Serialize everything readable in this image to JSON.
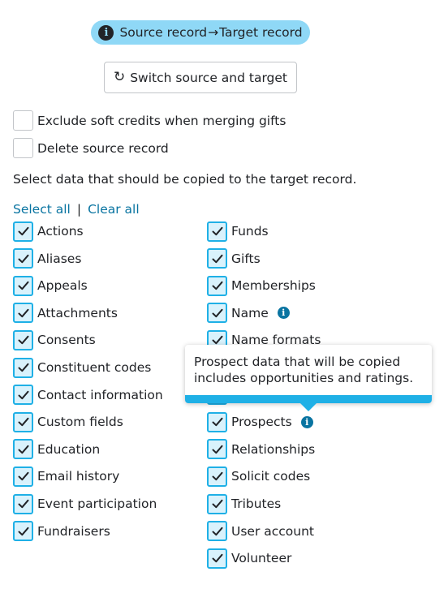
{
  "direction": {
    "source": "Source record",
    "arrow": "→",
    "target": "Target record",
    "icon": "info-icon"
  },
  "switch_button": {
    "label": "Switch source and target",
    "icon": "sync-icon"
  },
  "options": {
    "exclude_soft_credits": "Exclude soft credits when merging gifts",
    "delete_source": "Delete source record"
  },
  "help_text": "Select data that should be copied to the target record.",
  "links": {
    "select_all": "Select all",
    "separator": "|",
    "clear_all": "Clear all"
  },
  "left_items": [
    {
      "label": "Actions"
    },
    {
      "label": "Aliases"
    },
    {
      "label": "Appeals"
    },
    {
      "label": "Attachments"
    },
    {
      "label": "Consents"
    },
    {
      "label": "Constituent codes"
    },
    {
      "label": "Contact information"
    },
    {
      "label": "Custom fields"
    },
    {
      "label": "Education"
    },
    {
      "label": "Email history"
    },
    {
      "label": "Event participation"
    },
    {
      "label": "Fundraisers"
    }
  ],
  "right_items": [
    {
      "label": "Funds"
    },
    {
      "label": "Gifts"
    },
    {
      "label": "Memberships"
    },
    {
      "label": "Name"
    },
    {
      "label": "Name formats"
    },
    {
      "label": ""
    },
    {
      "label": ""
    },
    {
      "label": "Prospects"
    },
    {
      "label": "Relationships"
    },
    {
      "label": "Solicit codes"
    },
    {
      "label": "Tributes"
    },
    {
      "label": "User account"
    },
    {
      "label": "Volunteer"
    }
  ],
  "tooltip": {
    "text": "Prospect data that will be copied includes opportunities and ratings."
  },
  "colors": {
    "accent": "#1fb0e6",
    "pill": "#8fd8f6",
    "link": "#0974a1",
    "checkbox_fill": "#d9f2fc"
  }
}
